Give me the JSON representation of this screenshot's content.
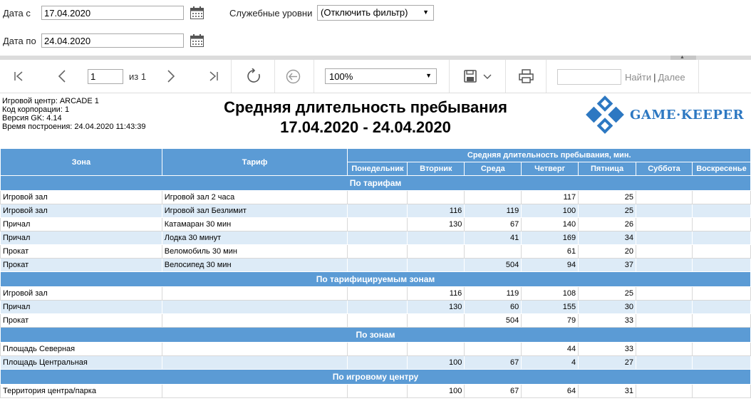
{
  "filters": {
    "date_from_label": "Дата с",
    "date_from_value": "17.04.2020",
    "date_to_label": "Дата по",
    "date_to_value": "24.04.2020",
    "service_levels_label": "Служебные уровни",
    "service_levels_value": "(Отключить фильтр)"
  },
  "toolbar": {
    "page_value": "1",
    "page_of": "из 1",
    "zoom_value": "100%",
    "find_label": "Найти",
    "find_next_label": "Далее",
    "find_separator": "|"
  },
  "report": {
    "meta": [
      "Игровой центр: ARCADE 1",
      "Код корпорации: 1",
      "Версия GK: 4.14",
      "Время построения: 24.04.2020 11:43:39"
    ],
    "title_line1": "Средняя длительность пребывания",
    "title_line2": "17.04.2020 - 24.04.2020",
    "logo_text": "GAME·KEEPER"
  },
  "table": {
    "col_zone": "Зона",
    "col_tariff": "Тариф",
    "col_group": "Средняя длительность пребывания, мин.",
    "days": [
      "Понедельник",
      "Вторник",
      "Среда",
      "Четверг",
      "Пятница",
      "Суббота",
      "Воскресенье"
    ],
    "sections": [
      {
        "title": "По тарифам",
        "rows": [
          {
            "zone": "Игровой зал",
            "tariff": "Игровой зал 2 часа",
            "values": [
              "",
              "",
              "",
              "117",
              "25",
              "",
              ""
            ]
          },
          {
            "zone": "Игровой зал",
            "tariff": "Игровой зал Безлимит",
            "values": [
              "",
              "116",
              "119",
              "100",
              "25",
              "",
              ""
            ]
          },
          {
            "zone": "Причал",
            "tariff": "Катамаран 30 мин",
            "values": [
              "",
              "130",
              "67",
              "140",
              "26",
              "",
              ""
            ]
          },
          {
            "zone": "Причал",
            "tariff": "Лодка 30 минут",
            "values": [
              "",
              "",
              "41",
              "169",
              "34",
              "",
              ""
            ]
          },
          {
            "zone": "Прокат",
            "tariff": "Веломобиль 30 мин",
            "values": [
              "",
              "",
              "",
              "61",
              "20",
              "",
              ""
            ]
          },
          {
            "zone": "Прокат",
            "tariff": "Велосипед 30 мин",
            "values": [
              "",
              "",
              "504",
              "94",
              "37",
              "",
              ""
            ]
          }
        ]
      },
      {
        "title": "По тарифицируемым зонам",
        "rows": [
          {
            "zone": "Игровой зал",
            "tariff": "",
            "values": [
              "",
              "116",
              "119",
              "108",
              "25",
              "",
              ""
            ]
          },
          {
            "zone": "Причал",
            "tariff": "",
            "values": [
              "",
              "130",
              "60",
              "155",
              "30",
              "",
              ""
            ]
          },
          {
            "zone": "Прокат",
            "tariff": "",
            "values": [
              "",
              "",
              "504",
              "79",
              "33",
              "",
              ""
            ]
          }
        ]
      },
      {
        "title": "По зонам",
        "rows": [
          {
            "zone": "Площадь Северная",
            "tariff": "",
            "values": [
              "",
              "",
              "",
              "44",
              "33",
              "",
              ""
            ]
          },
          {
            "zone": "Площадь Центральная",
            "tariff": "",
            "values": [
              "",
              "100",
              "67",
              "4",
              "27",
              "",
              ""
            ]
          }
        ]
      },
      {
        "title": "По игровому центру",
        "rows": [
          {
            "zone": "Территория центра/парка",
            "tariff": "",
            "values": [
              "",
              "100",
              "67",
              "64",
              "31",
              "",
              ""
            ]
          }
        ]
      }
    ]
  },
  "colors": {
    "header_blue": "#5b9bd5",
    "row_alt": "#ddebf7",
    "logo_blue": "#2d78c2"
  }
}
